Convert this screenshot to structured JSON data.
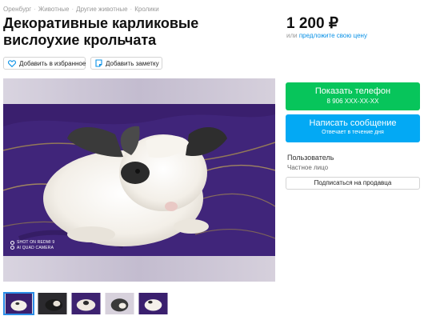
{
  "breadcrumb": [
    "Оренбург",
    "Животные",
    "Другие животные",
    "Кролики"
  ],
  "breadcrumb_separator": "·",
  "title": "Декоративные карликовые вислоухие крольчата",
  "price": {
    "value": "1 200 ₽",
    "sub_prefix": "или",
    "sub_link": "предложите свою цену"
  },
  "actions": {
    "favorite": "Добавить в избранное",
    "note": "Добавить заметку"
  },
  "photo": {
    "camera_line1": "SHOT ON REDMI 9",
    "camera_line2": "AI QUAD CAMERA",
    "thumbnail_count": 5,
    "active_thumbnail": 1
  },
  "contact": {
    "phone_label": "Показать телефон",
    "phone_masked": "8 906 XXX-XX-XX",
    "message_label": "Написать сообщение",
    "message_sub": "Отвечает в течение дня"
  },
  "seller": {
    "name": "Пользователь",
    "type": "Частное лицо",
    "subscribe": "Подписаться на продавца"
  },
  "colors": {
    "phone_button": "#07c55b",
    "message_button": "#03a9f4",
    "link": "#0a91e6",
    "thumb_active_border": "#2b8de6"
  },
  "icons": {
    "favorite": "heart-icon",
    "note": "note-icon"
  }
}
